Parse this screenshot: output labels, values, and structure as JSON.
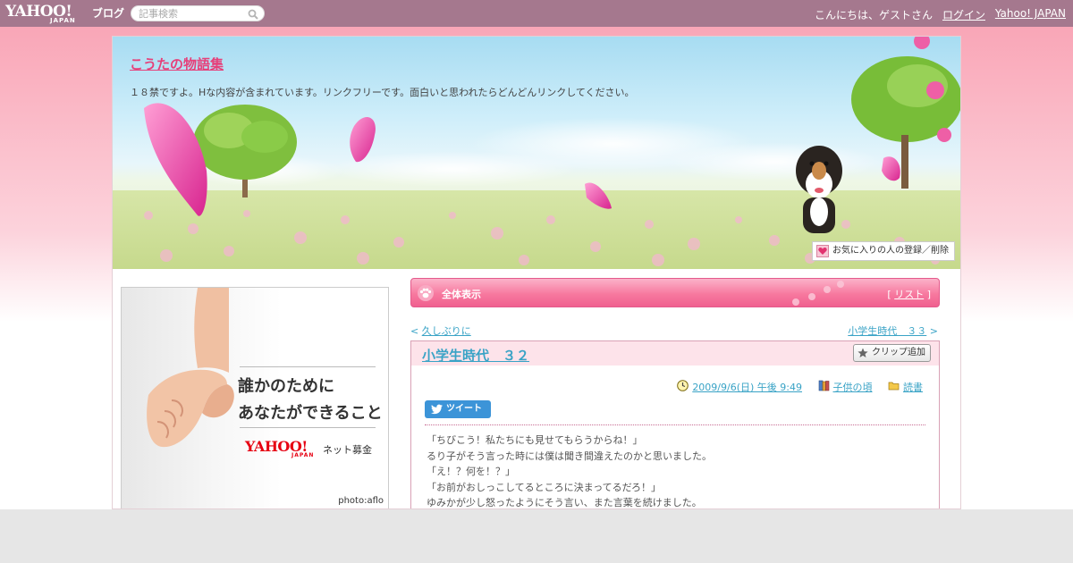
{
  "topbar": {
    "logo_main": "YAHOO!",
    "logo_sub": "JAPAN",
    "logo_blog": "ブログ",
    "search_placeholder": "記事検索",
    "greeting": "こんにちは、ゲストさん",
    "login": "ログイン",
    "yahoo_japan": "Yahoo! JAPAN"
  },
  "blog": {
    "title": "こうたの物語集",
    "description": "１８禁ですよ。Hな内容が含まれています。リンクフリーです。面白いと思われたらどんどんリンクしてください。",
    "fav_link": "お気に入りの人の登録／削除"
  },
  "ad": {
    "line1": "誰かのために",
    "line2": "あなたができること",
    "brand": "YAHOO!",
    "brand_sub": "JAPAN",
    "service": "ネット募金",
    "credit": "photo:aflo"
  },
  "category": {
    "title": "全体表示",
    "list_open": "[",
    "list_label": "リスト",
    "list_close": "]"
  },
  "nav": {
    "prev_arrow": "<",
    "prev_label": "久しぶりに",
    "next_label": "小学生時代　３３",
    "next_arrow": ">"
  },
  "article": {
    "title": "小学生時代　３２",
    "clip_label": "クリップ追加",
    "date": "2009/9/6(日) 午後 9:49",
    "category": "子供の頃",
    "genre": "読書",
    "tweet_label": "ツイート",
    "body_lines": [
      "「ちびこう！私たちにも見せてもらうからね！」",
      "るり子がそう言った時には僕は聞き間違えたのかと思いました。",
      "「え！？何を！？」",
      "「お前がおしっこしてるところに決まってるだろ！」",
      "ゆみかが少し怒ったようにそう言い、また言葉を続けました。"
    ]
  },
  "colors": {
    "topbar": "#a5788e",
    "title_pink": "#e6407a",
    "link_blue": "#39a3c6",
    "category_pink": "#f0608f"
  }
}
